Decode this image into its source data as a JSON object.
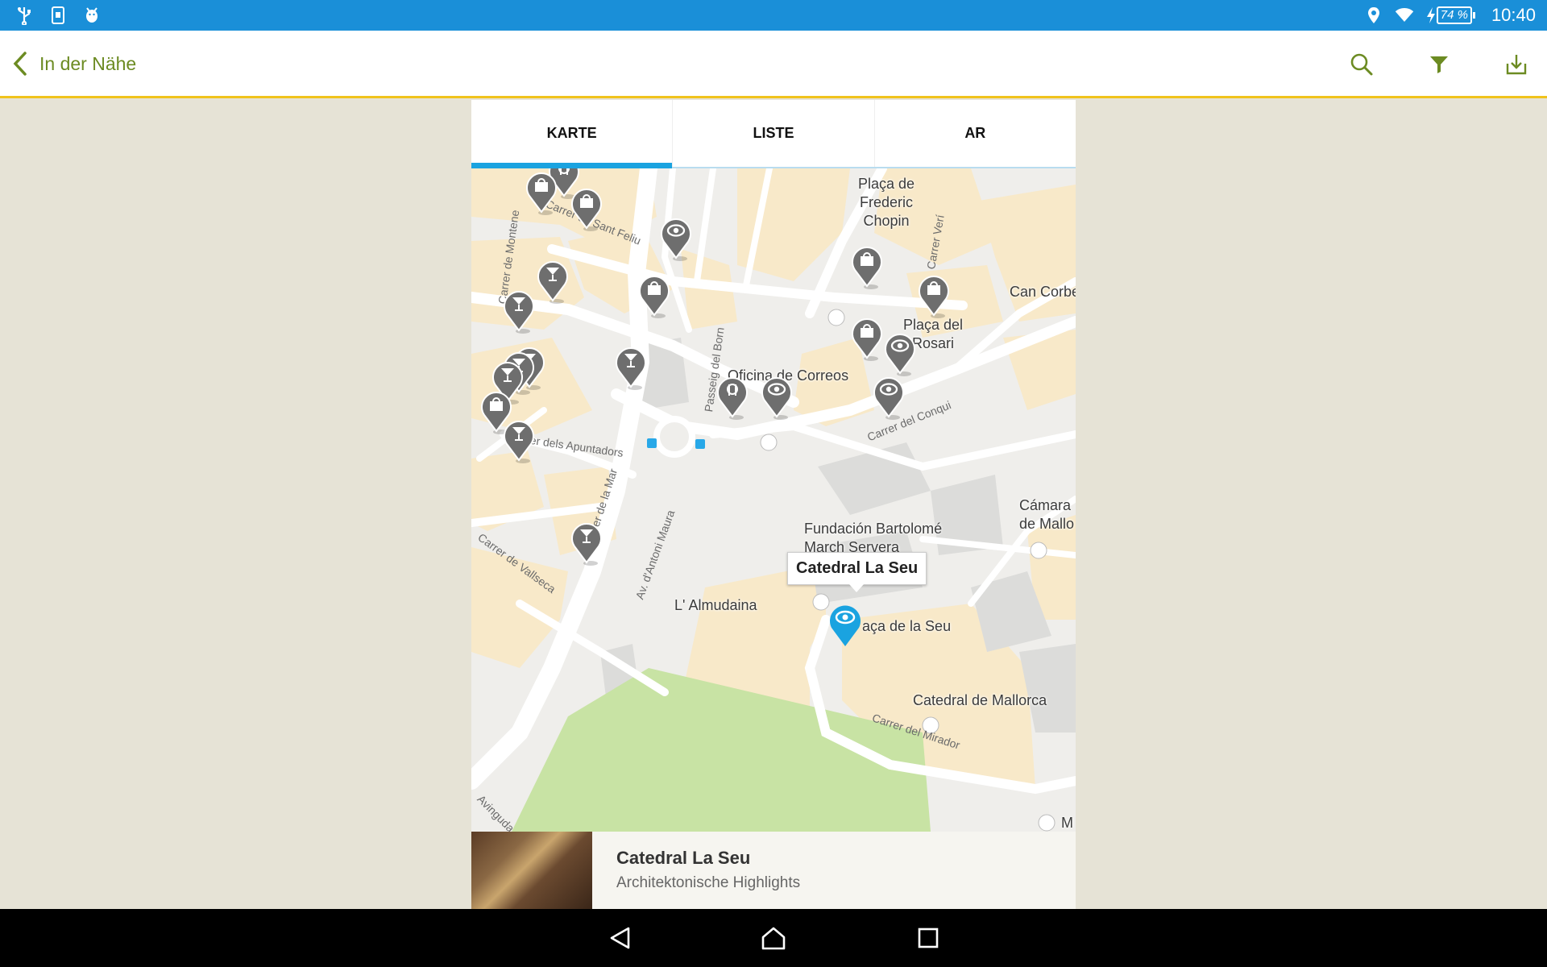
{
  "status_bar": {
    "icons_left": [
      "usb-icon",
      "sim-card-icon",
      "android-debug-icon"
    ],
    "icons_right": [
      "location-icon",
      "wifi-icon",
      "charging-bolt-icon",
      "battery-icon"
    ],
    "battery": "74 %",
    "time": "10:40"
  },
  "app_bar": {
    "title": "In der Nähe",
    "accent_color": "#6c8b22",
    "underline_color": "#f0c31c",
    "actions": [
      "search-icon",
      "filter-icon",
      "download-icon"
    ]
  },
  "tabs": [
    {
      "label": "KARTE",
      "active": true
    },
    {
      "label": "LISTE",
      "active": false
    },
    {
      "label": "AR",
      "active": false
    }
  ],
  "map": {
    "places": {
      "placa_chopin": "Plaça de\nFrederic\nChopin",
      "can_corbe": "Can Corbe",
      "placa_rosari": "Plaça del\nRosari",
      "correos": "Oficina de Correos",
      "fundacion": "Fundación Bartolomé\nMarch Servera",
      "camara": "Cámara\nde Mallo",
      "almudaina": "L' Almudaina",
      "placa_seu": "aça de la Seu",
      "catedral_mallorca": "Catedral de Mallorca",
      "edge_m": "M"
    },
    "streets": {
      "montenegro": "Carrer de Montene",
      "sant_feliu": "Carrer de Sant Feliu",
      "veri": "Carrer Verí",
      "born": "Passeig del Born",
      "apuntadors": "Carrer dels Apuntadors",
      "la_mar": "Carrer de la Mar",
      "antoni_maura": "Av. d'Antoni Maura",
      "vallseca": "Carrer de Vallseca",
      "conquista": "Carrer del Conqui",
      "mirador": "Carrer del Mirador",
      "avinguda": "Avinguda"
    },
    "callout": "Catedral La Seu",
    "selected_pin_color": "#1aa3e0",
    "pin_color": "#6e6e6e"
  },
  "card": {
    "title": "Catedral La Seu",
    "subtitle": "Architektonische Highlights"
  },
  "nav_bar": [
    "back-triangle-icon",
    "home-icon",
    "recents-icon"
  ]
}
